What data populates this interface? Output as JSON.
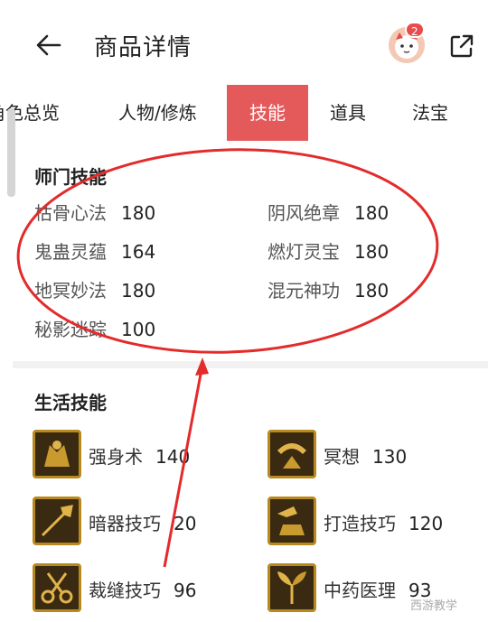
{
  "header": {
    "title": "商品详情",
    "badge_count": "2"
  },
  "tabs": [
    {
      "label": "角色总览"
    },
    {
      "label": "人物/修炼"
    },
    {
      "label": "技能"
    },
    {
      "label": "道具"
    },
    {
      "label": "法宝"
    }
  ],
  "school_skills": {
    "title": "师门技能",
    "items": [
      {
        "name": "枯骨心法",
        "value": "180"
      },
      {
        "name": "阴风绝章",
        "value": "180"
      },
      {
        "name": "鬼蛊灵蕴",
        "value": "164"
      },
      {
        "name": "燃灯灵宝",
        "value": "180"
      },
      {
        "name": "地冥妙法",
        "value": "180"
      },
      {
        "name": "混元神功",
        "value": "180"
      },
      {
        "name": "秘影迷踪",
        "value": "100"
      }
    ]
  },
  "life_skills": {
    "title": "生活技能",
    "items": [
      {
        "name": "强身术",
        "value": "140",
        "icon": "strength-icon"
      },
      {
        "name": "冥想",
        "value": "130",
        "icon": "meditation-icon"
      },
      {
        "name": "暗器技巧",
        "value": "20",
        "icon": "dart-icon"
      },
      {
        "name": "打造技巧",
        "value": "120",
        "icon": "forging-icon"
      },
      {
        "name": "裁缝技巧",
        "value": "96",
        "icon": "scissors-icon"
      },
      {
        "name": "中药医理",
        "value": "93",
        "icon": "herb-icon"
      }
    ]
  },
  "watermark": "西游教学",
  "colors": {
    "accent": "#e45a5a",
    "annotation": "#e32b2b",
    "icon_border": "#b8891e"
  }
}
